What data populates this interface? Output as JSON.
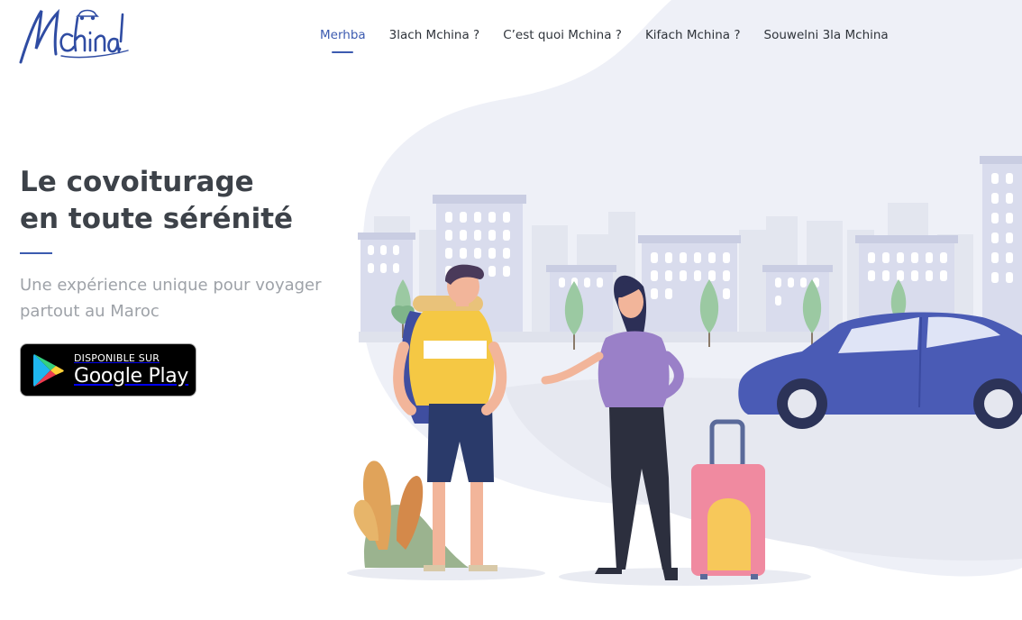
{
  "brand": {
    "logo_text": "Mchina!",
    "color": "#2f4ca3"
  },
  "nav": {
    "items": [
      {
        "label": "Merhba",
        "active": true
      },
      {
        "label": "3lach Mchina ?",
        "active": false
      },
      {
        "label": "C’est quoi Mchina ?",
        "active": false
      },
      {
        "label": "Kifach Mchina ?",
        "active": false
      },
      {
        "label": "Souwelni 3la Mchina",
        "active": false
      }
    ]
  },
  "hero": {
    "title_line1": "Le covoiturage",
    "title_line2": "en toute sérénité",
    "subtitle": "Une expérience unique pour voyager partout au Maroc"
  },
  "store_badge": {
    "small_text": "DISPONIBLE SUR",
    "big_text": "Google Play",
    "icon": "google-play-icon"
  },
  "colors": {
    "accent": "#3c5bb0",
    "title": "#3d4249",
    "subtitle": "#9ea2a8",
    "blob": "#eef0f7"
  }
}
